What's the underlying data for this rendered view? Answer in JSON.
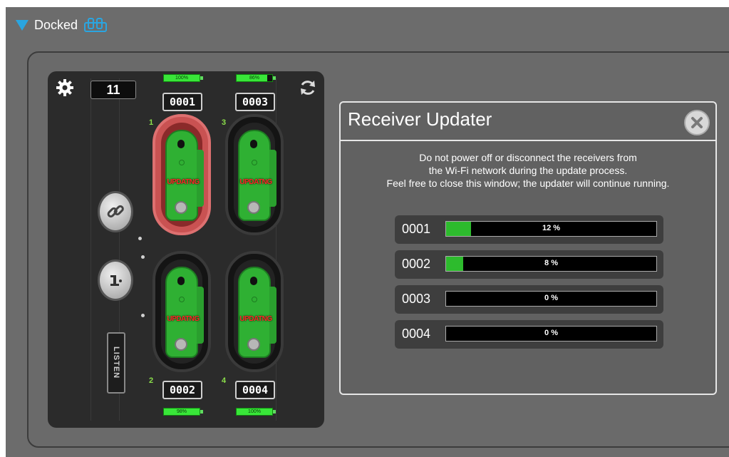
{
  "header": {
    "title": "Docked",
    "expander_icon": "triangle-down-icon",
    "status_icon": "dock-icon",
    "accent": "#2aa5e0"
  },
  "charger": {
    "receiver_count": "11",
    "slots": [
      {
        "number": "1",
        "id": "0001",
        "battery": "100%",
        "battery_level": 1.0,
        "status": "UPDATNG",
        "active": true
      },
      {
        "number": "3",
        "id": "0003",
        "battery": "86%",
        "battery_level": 0.86,
        "status": "UPDATNG",
        "active": false
      },
      {
        "number": "2",
        "id": "0002",
        "battery": "98%",
        "battery_level": 0.98,
        "status": "UPDATNG",
        "active": false
      },
      {
        "number": "4",
        "id": "0004",
        "battery": "100%",
        "battery_level": 1.0,
        "status": "UPDATNG",
        "active": false
      }
    ],
    "logo_text": "LISTEN"
  },
  "dialog": {
    "title": "Receiver Updater",
    "message": [
      "Do not power off or disconnect the receivers from",
      "the Wi-Fi network during the update process.",
      "Feel free to close this window; the updater will continue running."
    ],
    "progress": [
      {
        "id": "0001",
        "label": "12 %",
        "fraction": 0.12
      },
      {
        "id": "0002",
        "label": "8 %",
        "fraction": 0.08
      },
      {
        "id": "0003",
        "label": "0 %",
        "fraction": 0.0
      },
      {
        "id": "0004",
        "label": "0 %",
        "fraction": 0.0
      }
    ]
  }
}
